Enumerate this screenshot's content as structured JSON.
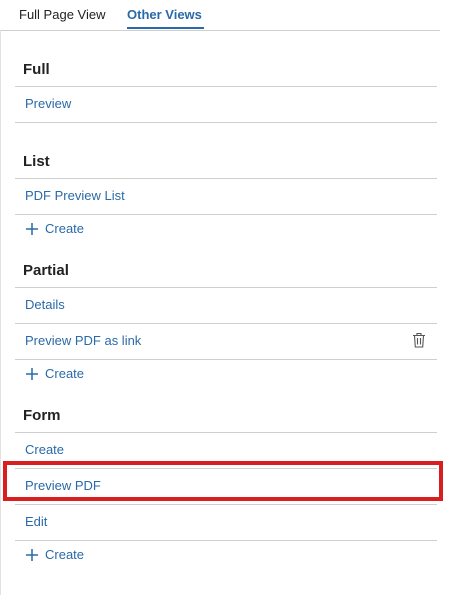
{
  "tabs": {
    "full_page_view": "Full Page View",
    "other_views": "Other Views"
  },
  "sections": {
    "full": {
      "title": "Full",
      "items": [
        "Preview"
      ]
    },
    "list": {
      "title": "List",
      "items": [
        "PDF Preview List"
      ],
      "create": "Create"
    },
    "partial": {
      "title": "Partial",
      "items": [
        "Details",
        "Preview PDF as link"
      ],
      "create": "Create"
    },
    "form": {
      "title": "Form",
      "items": [
        "Create",
        "Preview PDF",
        "Edit"
      ],
      "create": "Create"
    }
  },
  "highlight_color": "#d81e1e",
  "accent_color": "#2a6aa8",
  "icons": {
    "plus": "plus-icon",
    "trash": "trash-icon"
  }
}
